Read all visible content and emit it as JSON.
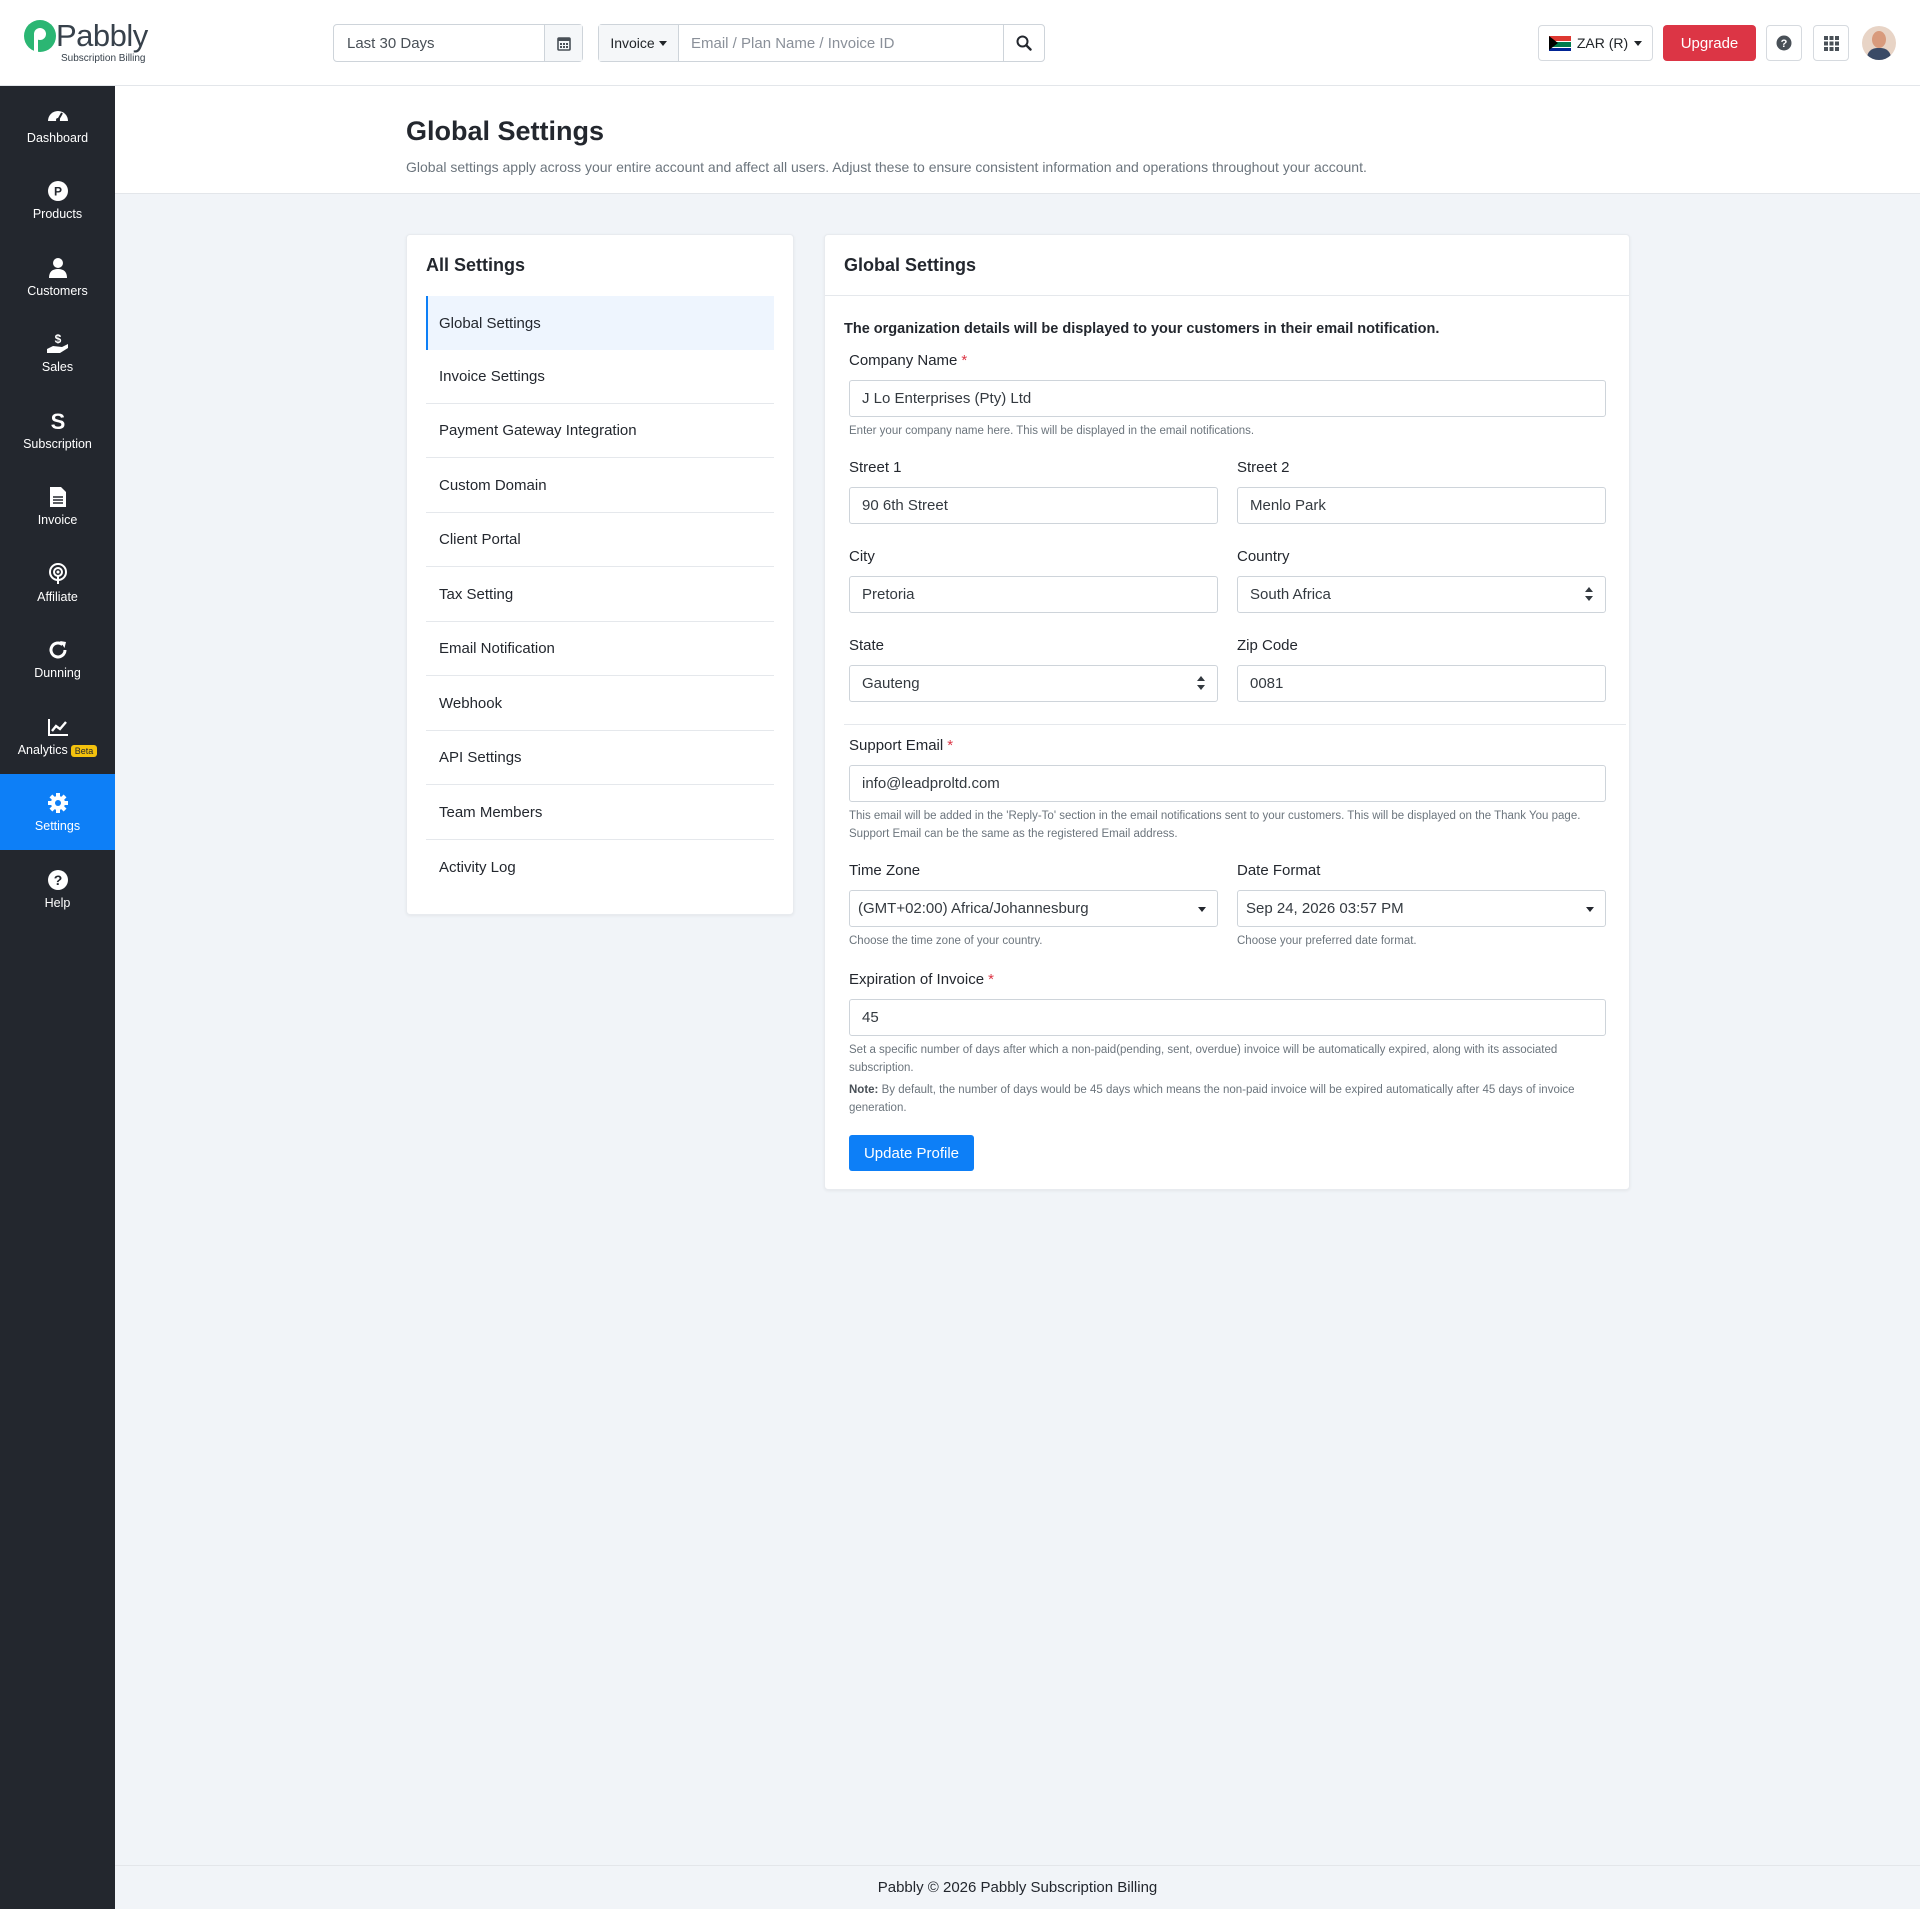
{
  "brand": {
    "name": "Pabbly",
    "sub": "Subscription Billing",
    "color": "#2bb673"
  },
  "header": {
    "date_range": "Last 30 Days",
    "search_type": "Invoice",
    "search_placeholder": "Email / Plan Name / Invoice ID",
    "currency": "ZAR (R)",
    "upgrade_label": "Upgrade"
  },
  "sidebar": {
    "items": [
      {
        "label": "Dashboard",
        "icon": "gauge-icon"
      },
      {
        "label": "Products",
        "icon": "product-icon"
      },
      {
        "label": "Customers",
        "icon": "user-icon"
      },
      {
        "label": "Sales",
        "icon": "sales-icon"
      },
      {
        "label": "Subscription",
        "icon": "subscription-icon"
      },
      {
        "label": "Invoice",
        "icon": "invoice-icon"
      },
      {
        "label": "Affiliate",
        "icon": "affiliate-icon"
      },
      {
        "label": "Dunning",
        "icon": "refresh-icon"
      },
      {
        "label": "Analytics",
        "icon": "chart-icon",
        "badge": "Beta"
      },
      {
        "label": "Settings",
        "icon": "gear-icon",
        "active": true
      },
      {
        "label": "Help",
        "icon": "help-icon"
      }
    ],
    "active_color": "#0d7ff7"
  },
  "page": {
    "title": "Global Settings",
    "description": "Global settings apply across your entire account and affect all users. Adjust these to ensure consistent information and operations throughout your account."
  },
  "settings_menu": {
    "title": "All Settings",
    "items": [
      "Global Settings",
      "Invoice Settings",
      "Payment Gateway Integration",
      "Custom Domain",
      "Client Portal",
      "Tax Setting",
      "Email Notification",
      "Webhook",
      "API Settings",
      "Team Members",
      "Activity Log"
    ]
  },
  "form": {
    "title": "Global Settings",
    "note": "The organization details will be displayed to your customers in their email notification.",
    "company_name": {
      "label": "Company Name",
      "value": "J Lo Enterprises (Pty) Ltd",
      "help": "Enter your company name here. This will be displayed in the email notifications."
    },
    "street1": {
      "label": "Street 1",
      "value": "90 6th Street"
    },
    "street2": {
      "label": "Street 2",
      "value": "Menlo Park"
    },
    "city": {
      "label": "City",
      "value": "Pretoria"
    },
    "country": {
      "label": "Country",
      "value": "South Africa"
    },
    "state": {
      "label": "State",
      "value": "Gauteng"
    },
    "zip": {
      "label": "Zip Code",
      "value": "0081"
    },
    "support_email": {
      "label": "Support Email",
      "value": "info@leadproltd.com",
      "help": "This email will be added in the 'Reply-To' section in the email notifications sent to your customers. This will be displayed on the Thank You page. Support Email can be the same as the registered Email address."
    },
    "time_zone": {
      "label": "Time Zone",
      "value": "(GMT+02:00) Africa/Johannesburg",
      "help": "Choose the time zone of your country."
    },
    "date_format": {
      "label": "Date Format",
      "value": "Sep 24, 2026 03:57 PM",
      "help": "Choose your preferred date format."
    },
    "expiration": {
      "label": "Expiration of Invoice",
      "value": "45",
      "help": "Set a specific number of days after which a non-paid(pending, sent, overdue) invoice will be automatically expired, along with its associated subscription.",
      "note_label": "Note:",
      "note": "By default, the number of days would be 45 days which means the non-paid invoice will be expired automatically after 45 days of invoice generation."
    },
    "required_mark": "*",
    "update_label": "Update Profile"
  },
  "footer": {
    "text": "Pabbly © 2026 Pabbly Subscription Billing"
  }
}
